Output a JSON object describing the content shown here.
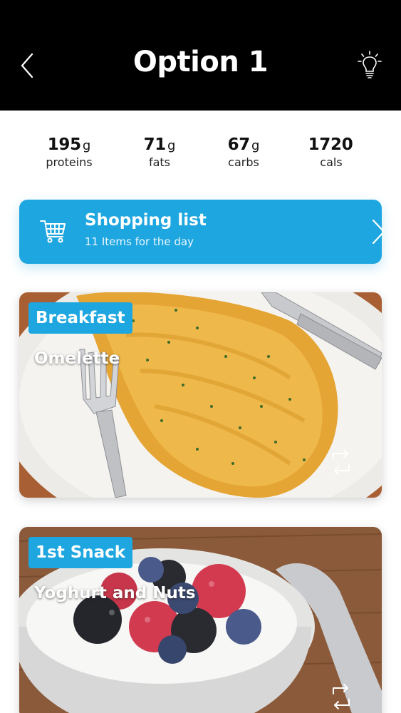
{
  "header": {
    "title": "Option 1",
    "background": "#000000"
  },
  "macros": [
    {
      "value": "195",
      "unit": "g",
      "label": "proteins"
    },
    {
      "value": "71",
      "unit": "g",
      "label": "fats"
    },
    {
      "value": "67",
      "unit": "g",
      "label": "carbs"
    },
    {
      "value": "1720",
      "unit": "",
      "label": "cals"
    }
  ],
  "shopping": {
    "title": "Shopping list",
    "subtitle": "11 Items for the day",
    "color": "#1ea6e0"
  },
  "meals": [
    {
      "category": "Breakfast",
      "name": "Omelette"
    },
    {
      "category": "1st Snack",
      "name": "Yoghurt and Nuts"
    }
  ],
  "icons": {
    "back": "chevron-left-icon",
    "tip": "lightbulb-icon",
    "cart": "shopping-cart-icon",
    "next": "chevron-right-icon",
    "swap": "swap-icon"
  }
}
